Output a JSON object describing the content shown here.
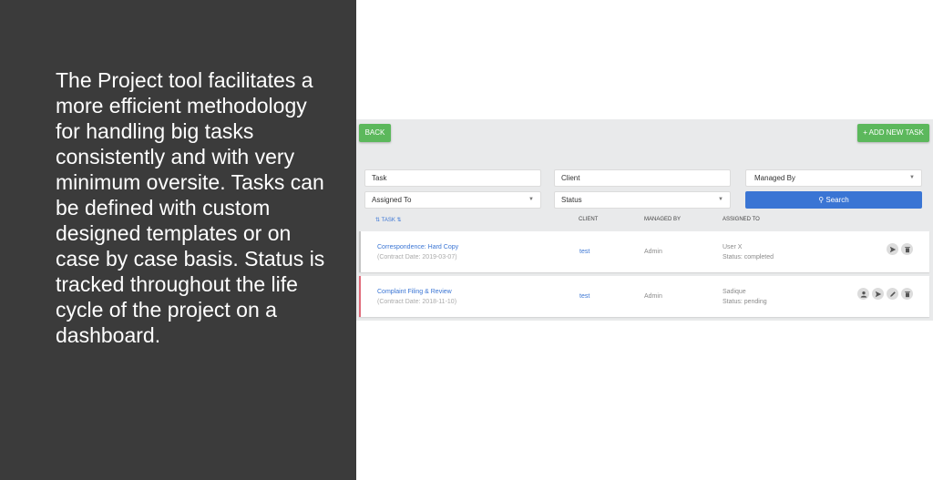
{
  "blurb": "The Project tool facilitates a more efficient methodology for handling big tasks consistently and with very minimum oversite. Tasks can be defined with custom designed templates or on case by case basis. Status is tracked throughout the life cycle of the project on a dashboard.",
  "toolbar": {
    "back_label": "BACK",
    "add_label": "+ ADD NEW TASK"
  },
  "filters": {
    "task_placeholder": "Task",
    "client_placeholder": "Client",
    "managed_by": "Managed By",
    "assigned_to": "Assigned To",
    "status": "Status",
    "search_label": "Search"
  },
  "table": {
    "columns": [
      "TASK",
      "CLIENT",
      "MANAGED BY",
      "ASSIGNED TO"
    ],
    "rows": [
      {
        "task": "Correspondence: Hard Copy",
        "date": "(Contract Date: 2019-03-07)",
        "client": "test",
        "managed_by": "Admin",
        "assigned_to": "User X",
        "status": "Status: completed",
        "icons": [
          "send-icon",
          "trash-icon"
        ]
      },
      {
        "task": "Complaint Filing & Review",
        "date": "(Contract Date: 2018-11-10)",
        "client": "test",
        "managed_by": "Admin",
        "assigned_to": "Sadique",
        "status": "Status: pending",
        "icons": [
          "user-icon",
          "send-icon",
          "edit-icon",
          "trash-icon"
        ]
      }
    ]
  },
  "colors": {
    "accent_green": "#5cb85c",
    "accent_blue": "#3a75d4",
    "pending_border": "#e06a7a",
    "sidebar_bg": "#3b3b3b"
  }
}
